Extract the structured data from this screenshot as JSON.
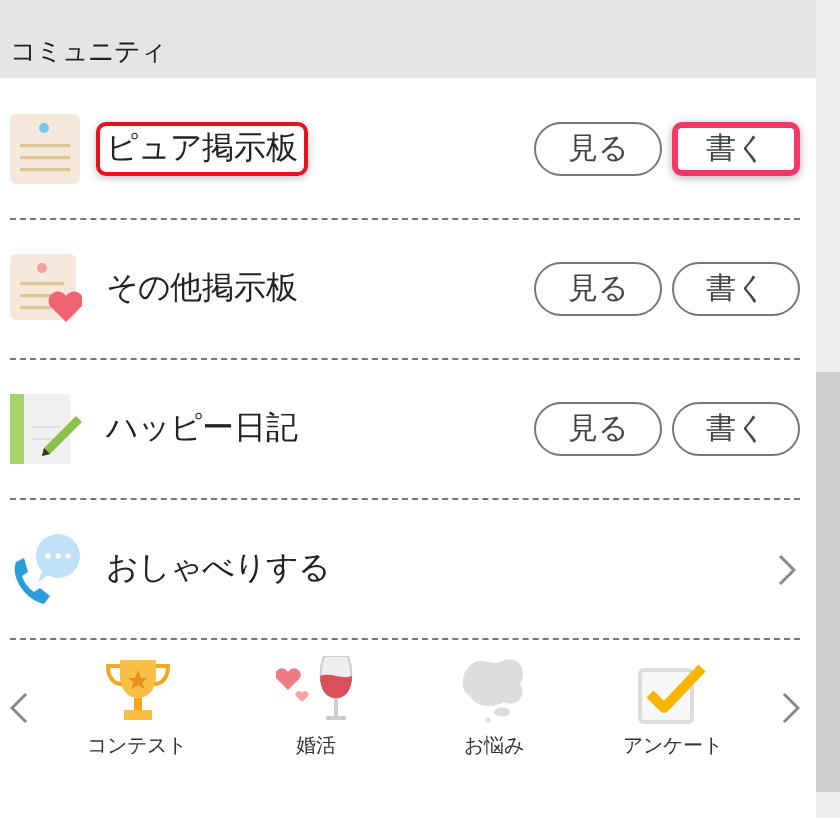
{
  "section_title": "コミュニティ",
  "items": [
    {
      "kind": "board",
      "title": "ピュア掲示板",
      "highlighted": true,
      "buttons": [
        {
          "label": "見る",
          "highlighted": false
        },
        {
          "label": "書く",
          "highlighted": true
        }
      ]
    },
    {
      "kind": "board",
      "title": "その他掲示板",
      "highlighted": false,
      "buttons": [
        {
          "label": "見る",
          "highlighted": false
        },
        {
          "label": "書く",
          "highlighted": false
        }
      ]
    },
    {
      "kind": "board",
      "title": "ハッピー日記",
      "highlighted": false,
      "buttons": [
        {
          "label": "見る",
          "highlighted": false
        },
        {
          "label": "書く",
          "highlighted": false
        }
      ]
    },
    {
      "kind": "link",
      "title": "おしゃべりする",
      "highlighted": false
    }
  ],
  "carousel": [
    {
      "label": "コンテスト"
    },
    {
      "label": "婚活"
    },
    {
      "label": "お悩み"
    },
    {
      "label": "アンケート"
    }
  ]
}
